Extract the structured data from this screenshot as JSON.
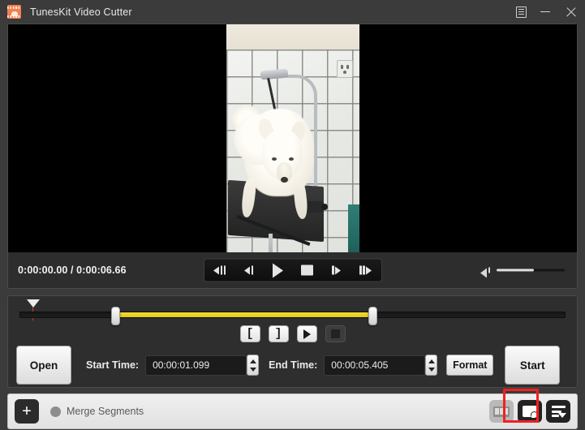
{
  "window": {
    "title": "TunesKit Video Cutter",
    "app_icon": "filmstrip-icon",
    "menu_icon": "menu-list-icon",
    "minimize_icon": "minimize-icon",
    "close_icon": "close-icon"
  },
  "player": {
    "current_time": "0:00:00.00",
    "separator": "/",
    "total_time": "0:00:06.66",
    "time_display": "0:00:00.00 / 0:00:06.66",
    "transport": [
      {
        "name": "step-back-group-button",
        "icon": "prev-frames-icon"
      },
      {
        "name": "step-back-button",
        "icon": "prev-frame-icon"
      },
      {
        "name": "play-button",
        "icon": "play-icon"
      },
      {
        "name": "stop-button",
        "icon": "stop-icon"
      },
      {
        "name": "step-forward-button",
        "icon": "next-frame-icon"
      },
      {
        "name": "step-forward-group-button",
        "icon": "next-frames-icon"
      }
    ],
    "volume": {
      "icon": "speaker-icon",
      "level_percent": 55
    }
  },
  "timeline": {
    "playhead_icon": "playhead-marker-icon",
    "playhead_position_percent": 1.5,
    "selection_start_percent": 17.5,
    "selection_end_percent": 64.8,
    "start_handle_icon": "range-start-handle",
    "end_handle_icon": "range-end-handle"
  },
  "segment_tools": [
    {
      "name": "set-start-point-button",
      "label": "[",
      "enabled": true
    },
    {
      "name": "set-end-point-button",
      "label": "]",
      "enabled": true
    },
    {
      "name": "preview-segment-button",
      "label": "",
      "icon": "play-preview-icon",
      "enabled": true
    },
    {
      "name": "stop-preview-button",
      "label": "",
      "icon": "stop-square-icon",
      "enabled": false
    }
  ],
  "controls": {
    "open_label": "Open",
    "start_time_label": "Start Time:",
    "start_time_value": "00:00:01.099",
    "end_time_label": "End Time:",
    "end_time_value": "00:00:05.405",
    "format_label": "Format",
    "start_label": "Start",
    "spinner_up_icon": "chevron-up-icon",
    "spinner_down_icon": "chevron-down-icon"
  },
  "bottom_bar": {
    "add_label": "+",
    "merge_label": "Merge Segments",
    "merge_checked": false,
    "icons": [
      {
        "name": "frames-extract-button",
        "icon": "filmstrip-icon",
        "enabled": false
      },
      {
        "name": "open-output-folder-button",
        "icon": "folder-clock-icon",
        "enabled": true,
        "highlighted": true
      },
      {
        "name": "task-list-button",
        "icon": "list-dropdown-icon",
        "enabled": true
      }
    ]
  },
  "colors": {
    "accent_yellow": "#f4dc2c",
    "highlight_red": "#f32020",
    "window_bg": "#3b3b3b",
    "panel_bg": "#2e2e2e",
    "bottom_bar_bg": "#e9e9e9",
    "app_icon_orange": "#f08050"
  }
}
